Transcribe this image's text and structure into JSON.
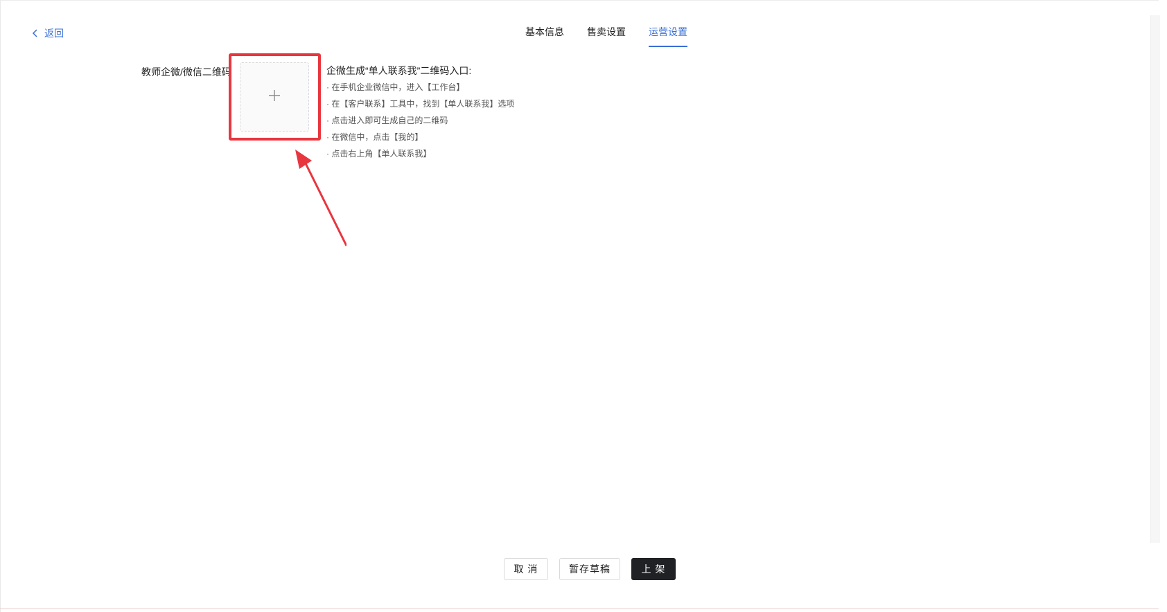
{
  "nav": {
    "back_label": "返回"
  },
  "tabs": [
    {
      "label": "基本信息",
      "active": false
    },
    {
      "label": "售卖设置",
      "active": false
    },
    {
      "label": "运营设置",
      "active": true
    }
  ],
  "form": {
    "qr_label": "教师企微/微信二维码",
    "upload_icon": "plus-icon"
  },
  "tips": {
    "title": "企微生成“单人联系我”二维码入口:",
    "items": [
      "· 在手机企业微信中，进入【工作台】",
      "· 在【客户联系】工具中，找到【单人联系我】选项",
      "· 点击进入即可生成自己的二维码",
      "· 在微信中，点击【我的】",
      "· 点击右上角【单人联系我】"
    ]
  },
  "footer": {
    "cancel_label": "取 消",
    "draft_label": "暂存草稿",
    "publish_label": "上 架"
  },
  "colors": {
    "accent": "#3a6fd6",
    "highlight": "#e8363f",
    "primary_button": "#1f2125"
  }
}
